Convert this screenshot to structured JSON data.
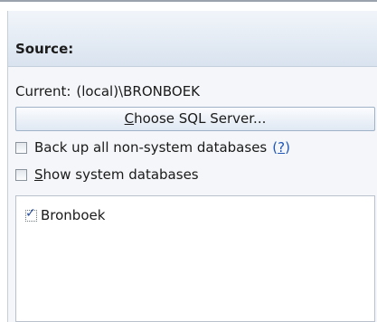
{
  "section": {
    "title": "Source:"
  },
  "current": {
    "label": "Current:",
    "value": "(local)\\BRONBOEK"
  },
  "choose_button": {
    "mnemonic": "C",
    "rest": "hoose SQL Server..."
  },
  "backup_all": {
    "label": "Back up all non-system databases",
    "checked": false,
    "help_open": "(",
    "help_q": "?",
    "help_close": ")"
  },
  "show_system": {
    "mnemonic": "S",
    "rest": "how system databases",
    "checked": false
  },
  "databases": {
    "items": [
      {
        "name": "Bronboek",
        "checked": true,
        "tick": "✓"
      }
    ]
  },
  "colors": {
    "link": "#1f56b8",
    "header_gradient_top": "#f1f5fa",
    "header_gradient_bottom": "#d9e3ef",
    "panel_background": "#f4f6f9"
  }
}
